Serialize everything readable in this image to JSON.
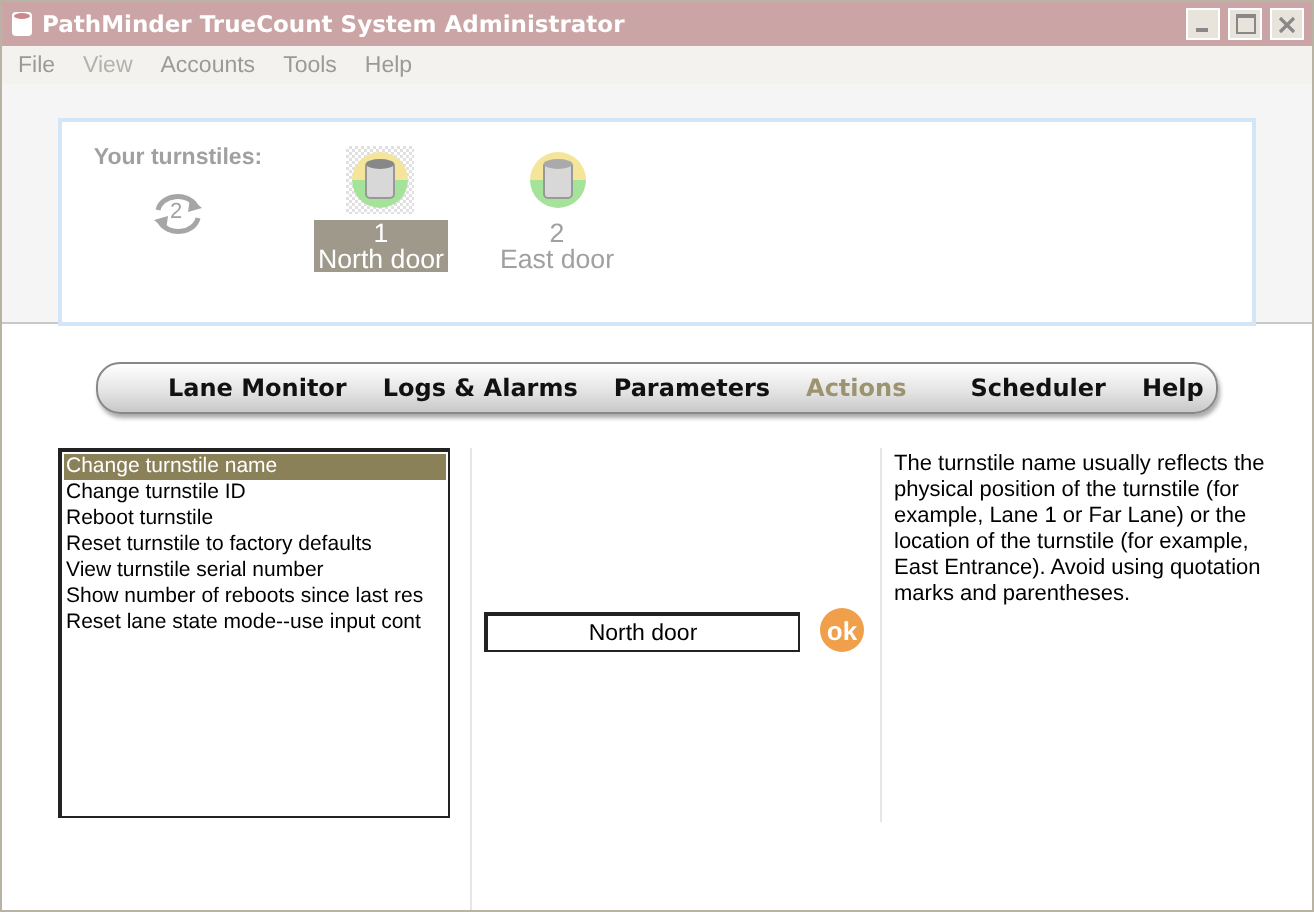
{
  "window": {
    "title": "PathMinder TrueCount System Administrator"
  },
  "menu": [
    {
      "label": "File",
      "disabled": false
    },
    {
      "label": "View",
      "disabled": true
    },
    {
      "label": "Accounts",
      "disabled": false
    },
    {
      "label": "Tools",
      "disabled": false
    },
    {
      "label": "Help",
      "disabled": false
    }
  ],
  "turnstiles_panel": {
    "label": "Your turnstiles:",
    "refresh_count": "2",
    "turnstiles": [
      {
        "number": "1",
        "name": "North door",
        "selected": true
      },
      {
        "number": "2",
        "name": "East door",
        "selected": false
      }
    ]
  },
  "nav_groups": [
    {
      "tabs": [
        {
          "label": "Lane Monitor",
          "selected": false
        },
        {
          "label": "Logs & Alarms",
          "selected": false
        },
        {
          "label": "Parameters",
          "selected": false
        },
        {
          "label": "Actions",
          "selected": true
        }
      ]
    },
    {
      "tabs": [
        {
          "label": "Scheduler",
          "selected": false
        },
        {
          "label": "Help",
          "selected": false
        }
      ]
    }
  ],
  "actions": [
    {
      "label": "Change turnstile name",
      "selected": true
    },
    {
      "label": "Change turnstile ID",
      "selected": false
    },
    {
      "label": "Reboot turnstile",
      "selected": false
    },
    {
      "label": "Reset turnstile to factory defaults",
      "selected": false
    },
    {
      "label": "View turnstile serial number",
      "selected": false
    },
    {
      "label": "Show number of reboots since last res",
      "selected": false
    },
    {
      "label": "Reset lane state mode--use input cont",
      "selected": false
    }
  ],
  "name_field": {
    "value": "North door"
  },
  "ok_button": {
    "label": "ok"
  },
  "help_text": "The turnstile name usually reflects the physical position of the turnstile (for example, Lane 1 or Far Lane) or the location of the turnstile (for example, East Entrance).  Avoid using quotation marks and parentheses."
}
